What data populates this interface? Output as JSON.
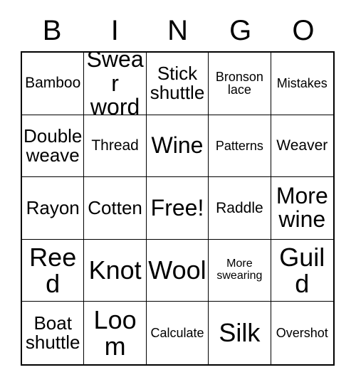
{
  "card": {
    "header_letters": [
      "B",
      "I",
      "N",
      "G",
      "O"
    ],
    "grid": {
      "rows": 5,
      "columns": 5,
      "border_color": "#000000",
      "background_color": "#ffffff",
      "text_color": "#000000"
    },
    "cells": [
      {
        "text": "Bamboo",
        "size": "sz-m"
      },
      {
        "text": "Swear word",
        "size": "sz-xl"
      },
      {
        "text": "Stick shuttle",
        "size": "sz-l"
      },
      {
        "text": "Bronson lace",
        "size": "sz-s"
      },
      {
        "text": "Mistakes",
        "size": "sz-s"
      },
      {
        "text": "Double weave",
        "size": "sz-l"
      },
      {
        "text": "Thread",
        "size": "sz-m"
      },
      {
        "text": "Wine",
        "size": "sz-xl"
      },
      {
        "text": "Patterns",
        "size": "sz-s"
      },
      {
        "text": "Weaver",
        "size": "sz-m"
      },
      {
        "text": "Rayon",
        "size": "sz-l"
      },
      {
        "text": "Cotten",
        "size": "sz-l"
      },
      {
        "text": "Free!",
        "size": "sz-xl"
      },
      {
        "text": "Raddle",
        "size": "sz-m"
      },
      {
        "text": "More wine",
        "size": "sz-xl"
      },
      {
        "text": "Reed",
        "size": "sz-xxl"
      },
      {
        "text": "Knot",
        "size": "sz-xxl"
      },
      {
        "text": "Wool",
        "size": "sz-xxl"
      },
      {
        "text": "More swearing",
        "size": "sz-xs"
      },
      {
        "text": "Guild",
        "size": "sz-xxl"
      },
      {
        "text": "Boat shuttle",
        "size": "sz-l"
      },
      {
        "text": "Loom",
        "size": "sz-xxl"
      },
      {
        "text": "Calculate",
        "size": "sz-s"
      },
      {
        "text": "Silk",
        "size": "sz-xxl"
      },
      {
        "text": "Overshot",
        "size": "sz-s"
      }
    ]
  }
}
